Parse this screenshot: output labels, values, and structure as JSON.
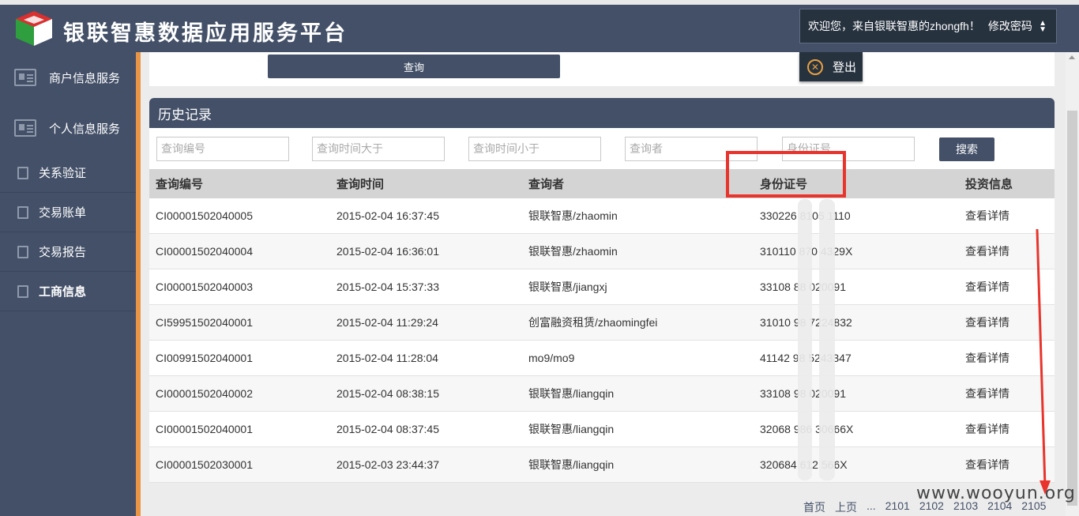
{
  "header": {
    "brand": "银联智惠数据应用服务平台",
    "welcome": "欢迎您，来自银联智惠的zhongfh！",
    "change_password": "修改密码",
    "logout": "登出"
  },
  "sidebar": {
    "items": [
      {
        "label": "商户信息服务"
      },
      {
        "label": "个人信息服务"
      },
      {
        "label": "关系验证"
      },
      {
        "label": "交易账单"
      },
      {
        "label": "交易报告"
      },
      {
        "label": "工商信息"
      }
    ]
  },
  "query_button": "查询",
  "history": {
    "title": "历史记录",
    "filters": {
      "query_id": "查询编号",
      "time_after": "查询时间大于",
      "time_before": "查询时间小于",
      "querier": "查询者",
      "id_number": "身份证号"
    },
    "search_button": "搜索",
    "columns": [
      "查询编号",
      "查询时间",
      "查询者",
      "身份证号",
      "投资信息"
    ],
    "rows": [
      {
        "id": "CI00001502040005",
        "time": "2015-02-04 16:37:45",
        "user": "银联智惠/zhaomin",
        "idno": "330226        8105     1110",
        "action": "查看详情"
      },
      {
        "id": "CI00001502040004",
        "time": "2015-02-04 16:36:01",
        "user": "银联智惠/zhaomin",
        "idno": "310110      870    4329X",
        "action": "查看详情"
      },
      {
        "id": "CI00001502040003",
        "time": "2015-02-04 15:37:33",
        "user": "银联智惠/jiangxj",
        "idno": "33108       88     020091",
        "action": "查看详情"
      },
      {
        "id": "CI59951502040001",
        "time": "2015-02-04 11:29:24",
        "user": "创富融资租赁/zhaomingfei",
        "idno": "31010       98      7224832",
        "action": "查看详情"
      },
      {
        "id": "CI00991502040001",
        "time": "2015-02-04 11:28:04",
        "user": "mo9/mo9",
        "idno": "41142       98     5243347",
        "action": "查看详情"
      },
      {
        "id": "CI00001502040002",
        "time": "2015-02-04 08:38:15",
        "user": "银联智惠/liangqin",
        "idno": "33108      98     020091",
        "action": "查看详情"
      },
      {
        "id": "CI00001502040001",
        "time": "2015-02-04 08:37:45",
        "user": "银联智惠/liangqin",
        "idno": "32068      986    30666X",
        "action": "查看详情"
      },
      {
        "id": "CI00001502030001",
        "time": "2015-02-03 23:44:37",
        "user": "银联智惠/liangqin",
        "idno": "320684      612     566X",
        "action": "查看详情"
      }
    ]
  },
  "pager": [
    "首页",
    "上页",
    "...",
    "2101",
    "2102",
    "2103",
    "2104",
    "2105"
  ],
  "watermark": "www.wooyun.org",
  "colors": {
    "primary": "#435068",
    "accent": "#e89545",
    "highlight": "#e8342c"
  }
}
